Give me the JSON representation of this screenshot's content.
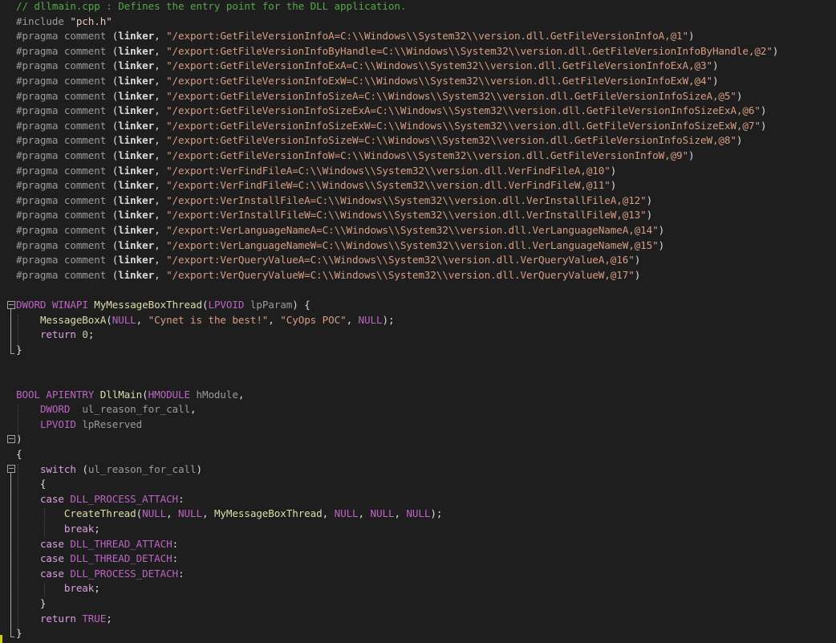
{
  "lines": [
    [
      [
        "c",
        "// dllmain.cpp : Defines the entry point for the DLL application."
      ]
    ],
    [
      [
        "pp",
        "#include "
      ],
      [
        "pps",
        "\"pch.h\""
      ]
    ],
    [
      [
        "pp",
        "#pragma comment "
      ],
      [
        "p",
        "("
      ],
      [
        "b",
        "linker"
      ],
      [
        "p",
        ", "
      ],
      [
        "s",
        "\"/export:GetFileVersionInfoA=C:\\\\Windows\\\\System32\\\\version.dll.GetFileVersionInfoA,@1\""
      ],
      [
        "p",
        ")"
      ]
    ],
    [
      [
        "pp",
        "#pragma comment "
      ],
      [
        "p",
        "("
      ],
      [
        "b",
        "linker"
      ],
      [
        "p",
        ", "
      ],
      [
        "s",
        "\"/export:GetFileVersionInfoByHandle=C:\\\\Windows\\\\System32\\\\version.dll.GetFileVersionInfoByHandle,@2\""
      ],
      [
        "p",
        ")"
      ]
    ],
    [
      [
        "pp",
        "#pragma comment "
      ],
      [
        "p",
        "("
      ],
      [
        "b",
        "linker"
      ],
      [
        "p",
        ", "
      ],
      [
        "s",
        "\"/export:GetFileVersionInfoExA=C:\\\\Windows\\\\System32\\\\version.dll.GetFileVersionInfoExA,@3\""
      ],
      [
        "p",
        ")"
      ]
    ],
    [
      [
        "pp",
        "#pragma comment "
      ],
      [
        "p",
        "("
      ],
      [
        "b",
        "linker"
      ],
      [
        "p",
        ", "
      ],
      [
        "s",
        "\"/export:GetFileVersionInfoExW=C:\\\\Windows\\\\System32\\\\version.dll.GetFileVersionInfoExW,@4\""
      ],
      [
        "p",
        ")"
      ]
    ],
    [
      [
        "pp",
        "#pragma comment "
      ],
      [
        "p",
        "("
      ],
      [
        "b",
        "linker"
      ],
      [
        "p",
        ", "
      ],
      [
        "s",
        "\"/export:GetFileVersionInfoSizeA=C:\\\\Windows\\\\System32\\\\version.dll.GetFileVersionInfoSizeA,@5\""
      ],
      [
        "p",
        ")"
      ]
    ],
    [
      [
        "pp",
        "#pragma comment "
      ],
      [
        "p",
        "("
      ],
      [
        "b",
        "linker"
      ],
      [
        "p",
        ", "
      ],
      [
        "s",
        "\"/export:GetFileVersionInfoSizeExA=C:\\\\Windows\\\\System32\\\\version.dll.GetFileVersionInfoSizeExA,@6\""
      ],
      [
        "p",
        ")"
      ]
    ],
    [
      [
        "pp",
        "#pragma comment "
      ],
      [
        "p",
        "("
      ],
      [
        "b",
        "linker"
      ],
      [
        "p",
        ", "
      ],
      [
        "s",
        "\"/export:GetFileVersionInfoSizeExW=C:\\\\Windows\\\\System32\\\\version.dll.GetFileVersionInfoSizeExW,@7\""
      ],
      [
        "p",
        ")"
      ]
    ],
    [
      [
        "pp",
        "#pragma comment "
      ],
      [
        "p",
        "("
      ],
      [
        "b",
        "linker"
      ],
      [
        "p",
        ", "
      ],
      [
        "s",
        "\"/export:GetFileVersionInfoSizeW=C:\\\\Windows\\\\System32\\\\version.dll.GetFileVersionInfoSizeW,@8\""
      ],
      [
        "p",
        ")"
      ]
    ],
    [
      [
        "pp",
        "#pragma comment "
      ],
      [
        "p",
        "("
      ],
      [
        "b",
        "linker"
      ],
      [
        "p",
        ", "
      ],
      [
        "s",
        "\"/export:GetFileVersionInfoW=C:\\\\Windows\\\\System32\\\\version.dll.GetFileVersionInfoW,@9\""
      ],
      [
        "p",
        ")"
      ]
    ],
    [
      [
        "pp",
        "#pragma comment "
      ],
      [
        "p",
        "("
      ],
      [
        "b",
        "linker"
      ],
      [
        "p",
        ", "
      ],
      [
        "s",
        "\"/export:VerFindFileA=C:\\\\Windows\\\\System32\\\\version.dll.VerFindFileA,@10\""
      ],
      [
        "p",
        ")"
      ]
    ],
    [
      [
        "pp",
        "#pragma comment "
      ],
      [
        "p",
        "("
      ],
      [
        "b",
        "linker"
      ],
      [
        "p",
        ", "
      ],
      [
        "s",
        "\"/export:VerFindFileW=C:\\\\Windows\\\\System32\\\\version.dll.VerFindFileW,@11\""
      ],
      [
        "p",
        ")"
      ]
    ],
    [
      [
        "pp",
        "#pragma comment "
      ],
      [
        "p",
        "("
      ],
      [
        "b",
        "linker"
      ],
      [
        "p",
        ", "
      ],
      [
        "s",
        "\"/export:VerInstallFileA=C:\\\\Windows\\\\System32\\\\version.dll.VerInstallFileA,@12\""
      ],
      [
        "p",
        ")"
      ]
    ],
    [
      [
        "pp",
        "#pragma comment "
      ],
      [
        "p",
        "("
      ],
      [
        "b",
        "linker"
      ],
      [
        "p",
        ", "
      ],
      [
        "s",
        "\"/export:VerInstallFileW=C:\\\\Windows\\\\System32\\\\version.dll.VerInstallFileW,@13\""
      ],
      [
        "p",
        ")"
      ]
    ],
    [
      [
        "pp",
        "#pragma comment "
      ],
      [
        "p",
        "("
      ],
      [
        "b",
        "linker"
      ],
      [
        "p",
        ", "
      ],
      [
        "s",
        "\"/export:VerLanguageNameA=C:\\\\Windows\\\\System32\\\\version.dll.VerLanguageNameA,@14\""
      ],
      [
        "p",
        ")"
      ]
    ],
    [
      [
        "pp",
        "#pragma comment "
      ],
      [
        "p",
        "("
      ],
      [
        "b",
        "linker"
      ],
      [
        "p",
        ", "
      ],
      [
        "s",
        "\"/export:VerLanguageNameW=C:\\\\Windows\\\\System32\\\\version.dll.VerLanguageNameW,@15\""
      ],
      [
        "p",
        ")"
      ]
    ],
    [
      [
        "pp",
        "#pragma comment "
      ],
      [
        "p",
        "("
      ],
      [
        "b",
        "linker"
      ],
      [
        "p",
        ", "
      ],
      [
        "s",
        "\"/export:VerQueryValueA=C:\\\\Windows\\\\System32\\\\version.dll.VerQueryValueA,@16\""
      ],
      [
        "p",
        ")"
      ]
    ],
    [
      [
        "pp",
        "#pragma comment "
      ],
      [
        "p",
        "("
      ],
      [
        "b",
        "linker"
      ],
      [
        "p",
        ", "
      ],
      [
        "s",
        "\"/export:VerQueryValueW=C:\\\\Windows\\\\System32\\\\version.dll.VerQueryValueW,@17\""
      ],
      [
        "p",
        ")"
      ]
    ],
    [],
    [
      [
        "m",
        "DWORD"
      ],
      [
        "p",
        " "
      ],
      [
        "m",
        "WINAPI"
      ],
      [
        "p",
        " "
      ],
      [
        "f",
        "MyMessageBoxThread"
      ],
      [
        "p",
        "("
      ],
      [
        "m",
        "LPVOID"
      ],
      [
        "p",
        " "
      ],
      [
        "a",
        "lpParam"
      ],
      [
        "p",
        ") {"
      ]
    ],
    [
      [
        "p",
        "    "
      ],
      [
        "f",
        "MessageBoxA"
      ],
      [
        "p",
        "("
      ],
      [
        "m",
        "NULL"
      ],
      [
        "p",
        ", "
      ],
      [
        "s",
        "\"Cynet is the best!\""
      ],
      [
        "p",
        ", "
      ],
      [
        "s",
        "\"CyOps POC\""
      ],
      [
        "p",
        ", "
      ],
      [
        "m",
        "NULL"
      ],
      [
        "p",
        ");"
      ]
    ],
    [
      [
        "p",
        "    "
      ],
      [
        "k",
        "return"
      ],
      [
        "p",
        " "
      ],
      [
        "n",
        "0"
      ],
      [
        "p",
        ";"
      ]
    ],
    [
      [
        "p",
        "}"
      ]
    ],
    [],
    [],
    [
      [
        "m",
        "BOOL"
      ],
      [
        "p",
        " "
      ],
      [
        "m",
        "APIENTRY"
      ],
      [
        "p",
        " "
      ],
      [
        "f",
        "DllMain"
      ],
      [
        "p",
        "("
      ],
      [
        "m",
        "HMODULE"
      ],
      [
        "p",
        " "
      ],
      [
        "a",
        "hModule"
      ],
      [
        "p",
        ","
      ]
    ],
    [
      [
        "p",
        "    "
      ],
      [
        "m",
        "DWORD"
      ],
      [
        "p",
        "  "
      ],
      [
        "a",
        "ul_reason_for_call"
      ],
      [
        "p",
        ","
      ]
    ],
    [
      [
        "p",
        "    "
      ],
      [
        "m",
        "LPVOID"
      ],
      [
        "p",
        " "
      ],
      [
        "a",
        "lpReserved"
      ]
    ],
    [
      [
        "p",
        ")"
      ]
    ],
    [
      [
        "p",
        "{"
      ]
    ],
    [
      [
        "p",
        "    "
      ],
      [
        "k",
        "switch"
      ],
      [
        "p",
        " ("
      ],
      [
        "a",
        "ul_reason_for_call"
      ],
      [
        "p",
        ")"
      ]
    ],
    [
      [
        "p",
        "    {"
      ]
    ],
    [
      [
        "p",
        "    "
      ],
      [
        "k",
        "case"
      ],
      [
        "p",
        " "
      ],
      [
        "m",
        "DLL_PROCESS_ATTACH"
      ],
      [
        "p",
        ":"
      ]
    ],
    [
      [
        "p",
        "        "
      ],
      [
        "f",
        "CreateThread"
      ],
      [
        "p",
        "("
      ],
      [
        "m",
        "NULL"
      ],
      [
        "p",
        ", "
      ],
      [
        "m",
        "NULL"
      ],
      [
        "p",
        ", "
      ],
      [
        "f",
        "MyMessageBoxThread"
      ],
      [
        "p",
        ", "
      ],
      [
        "m",
        "NULL"
      ],
      [
        "p",
        ", "
      ],
      [
        "m",
        "NULL"
      ],
      [
        "p",
        ", "
      ],
      [
        "m",
        "NULL"
      ],
      [
        "p",
        ");"
      ]
    ],
    [
      [
        "p",
        "        "
      ],
      [
        "k",
        "break"
      ],
      [
        "p",
        ";"
      ]
    ],
    [
      [
        "p",
        "    "
      ],
      [
        "k",
        "case"
      ],
      [
        "p",
        " "
      ],
      [
        "m",
        "DLL_THREAD_ATTACH"
      ],
      [
        "p",
        ":"
      ]
    ],
    [
      [
        "p",
        "    "
      ],
      [
        "k",
        "case"
      ],
      [
        "p",
        " "
      ],
      [
        "m",
        "DLL_THREAD_DETACH"
      ],
      [
        "p",
        ":"
      ]
    ],
    [
      [
        "p",
        "    "
      ],
      [
        "k",
        "case"
      ],
      [
        "p",
        " "
      ],
      [
        "m",
        "DLL_PROCESS_DETACH"
      ],
      [
        "p",
        ":"
      ]
    ],
    [
      [
        "p",
        "        "
      ],
      [
        "k",
        "break"
      ],
      [
        "p",
        ";"
      ]
    ],
    [
      [
        "p",
        "    }"
      ]
    ],
    [
      [
        "p",
        "    "
      ],
      [
        "k",
        "return"
      ],
      [
        "p",
        " "
      ],
      [
        "m",
        "TRUE"
      ],
      [
        "p",
        ";"
      ]
    ],
    [
      [
        "p",
        "}"
      ]
    ]
  ],
  "colors": {
    "background": "#1e1e1e",
    "comment": "#57a64a",
    "string": "#d69d85",
    "keyword": "#d8a0df",
    "macro": "#bd63c5",
    "function": "#dcdcaa"
  }
}
